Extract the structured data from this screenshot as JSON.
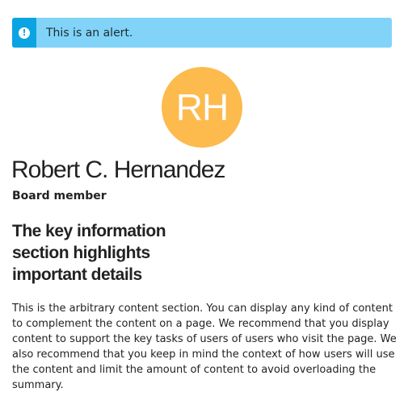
{
  "alert": {
    "icon": "info-icon",
    "icon_glyph": "!",
    "text": "This is an alert."
  },
  "profile": {
    "initials": "RH",
    "name": "Robert C. Hernandez",
    "role": "Board member"
  },
  "key_information": "The key information section highlights important details",
  "content": "This is the arbitrary content section. You can display any kind of content to complement the content on a page. We recommend that you display content to support the key tasks of users of users who visit the page. We also recommend that you keep in mind the context of how users will use the content and limit the amount of content to avoid overloading the summary.",
  "colors": {
    "alert_background": "#81d4f8",
    "alert_strip": "#0ba4e3",
    "avatar_background": "#fdba4d",
    "text": "#222222"
  }
}
